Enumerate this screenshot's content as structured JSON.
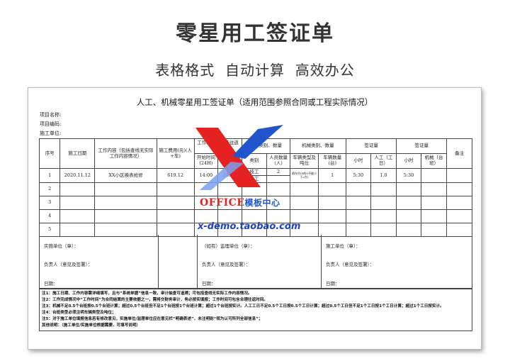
{
  "hero": {
    "title": "零星用工签证单",
    "subtitle": "表格格式  自动计算  高效办公"
  },
  "doc": {
    "title": "人工、机械零星用工签证单（适用范围参照合同或工程实际情况）",
    "meta": [
      "项目名称:",
      "项目编码:",
      "施工单位:"
    ]
  },
  "table": {
    "h_seq": "序号",
    "h_date": "施工日期",
    "h_content": "工作内容（包括查线无实际工作内容情况）",
    "h_cost": "施工费用(元)(人+车)",
    "h_time": "工作时间（包括往返时间）",
    "h_start": "开始时间(24H)",
    "h_end": "结束时间",
    "h_worker": "人工类别、数量",
    "h_worker_type": "类别",
    "h_worker_qty": "人员数量(人)",
    "h_mach": "机械类别、数量",
    "h_mach_type": "车辆类型及吨位",
    "h_mach_qty": "车辆数量(台)",
    "h_cert1": "签证量",
    "h_cert2": "签证量",
    "h_hour1": "小时",
    "h_labor": "人工（工日）",
    "h_hour2": "小时",
    "h_machine": "机械（台班）",
    "h_remark": "备注",
    "rows": [
      {
        "seq": "1",
        "date": "2020.11.12",
        "content": "XX小区换表抢修",
        "cost": "619.12",
        "start": "14:00",
        "end": "16:30",
        "wtype1": "技工",
        "wtype2": "小工",
        "wqty": "2",
        "mtype": "随车吊(8吨)(不能少于2台)",
        "mqty": "1",
        "hour1": "5:30",
        "labor": "1.0",
        "hour2": "5:30"
      },
      {
        "seq": "2"
      },
      {
        "seq": "3"
      },
      {
        "seq": "4"
      },
      {
        "seq": "5"
      }
    ]
  },
  "sign": {
    "impl_unit": "实施单位（章）：",
    "impl_person": "负责人（意见及签署）：",
    "impl_date": "日期：",
    "sup_unit": "（如有）监理单位（章）：",
    "sup_person": "负责人（意见及签署）：",
    "sup_date": "日期：",
    "con_unit": "施工单位（章）：",
    "con_person": "负责人（意见及签署）：",
    "con_date": "日期："
  },
  "notes": [
    "注1：施工日期、工作内容需详细填写，且与“系统单据”信息一致，审计抽查可追溯；可包括查线无实际工作内容情况。",
    "注2：工作完成情况中“工作时间”为合同结算的主要依据之一，需将交财务审计，务必按实填报；工作时间可包含合理往返时间。",
    "注3：机械不足0.5个台班按0.5个台班计算；超过0.5个台班但不足1个台班按1个台班计算；超过1个台班按实计。人工工日不足0.5个工日按0.5个工日计算；超过0.5个工日但不足1个工日按1个工日计算；超过1个工日按实计。",
    "注4：台班类型必须注明车辆类型及吨位；",
    "注5：对于施工单位填报信息若有修改意见，实施单位/监理单位应在意见栏“明确表述”，未注明则“视为认可所列全部信息”；",
    "其他说明：（施工单位/实施单位根据需要，可填写说明）"
  ],
  "watermark": {
    "brand": "OFFICE",
    "brand_cn": "模板中心",
    "url": "x-demo.taobao.com"
  },
  "colors": {
    "brand_red": "#e52222",
    "brand_blue": "#2255cc"
  }
}
